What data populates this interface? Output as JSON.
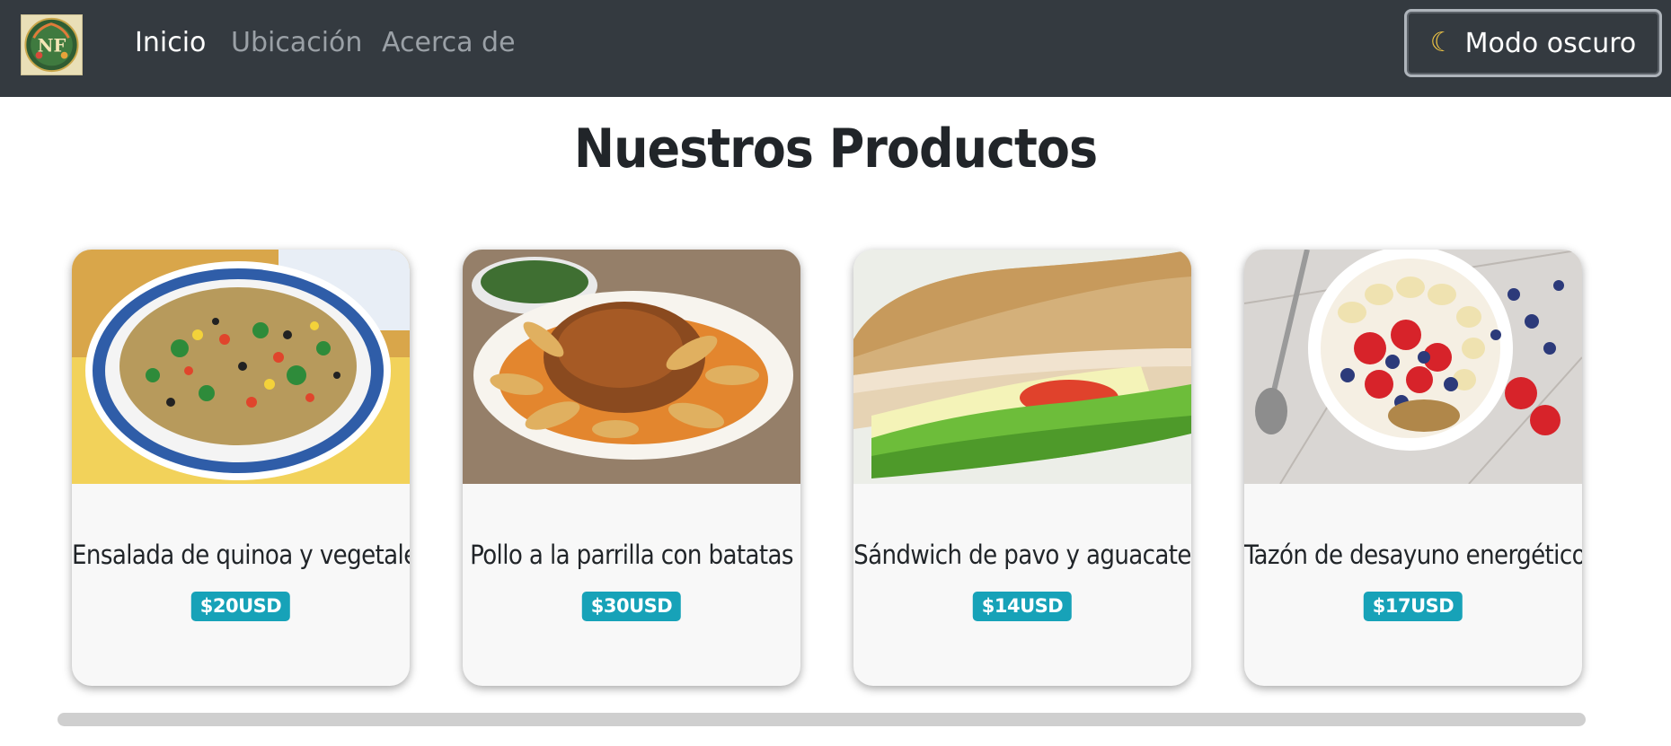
{
  "navbar": {
    "logo_text": "NF",
    "links": [
      {
        "label": "Inicio"
      },
      {
        "label": "Ubicación"
      },
      {
        "label": "Acerca de"
      }
    ],
    "dark_mode_label": "Modo oscuro",
    "dark_mode_icon": "moon-icon"
  },
  "main": {
    "title": "Nuestros Productos",
    "products": [
      {
        "name": "Ensalada de quinoa y vegetales",
        "price": "$20USD",
        "image": "quinoa-salad-image"
      },
      {
        "name": "Pollo a la parrilla con batatas",
        "price": "$30USD",
        "image": "grilled-chicken-image"
      },
      {
        "name": "Sándwich de pavo y aguacate",
        "price": "$14USD",
        "image": "turkey-sandwich-image"
      },
      {
        "name": "Tazón de desayuno energético",
        "price": "$17USD",
        "image": "breakfast-bowl-image"
      }
    ]
  },
  "colors": {
    "navbar_bg": "#343a40",
    "badge_bg": "#17a2b8",
    "card_bg": "#f8f8f8",
    "nav_active": "#ffffff",
    "nav_inactive": "#9aa0a6"
  }
}
